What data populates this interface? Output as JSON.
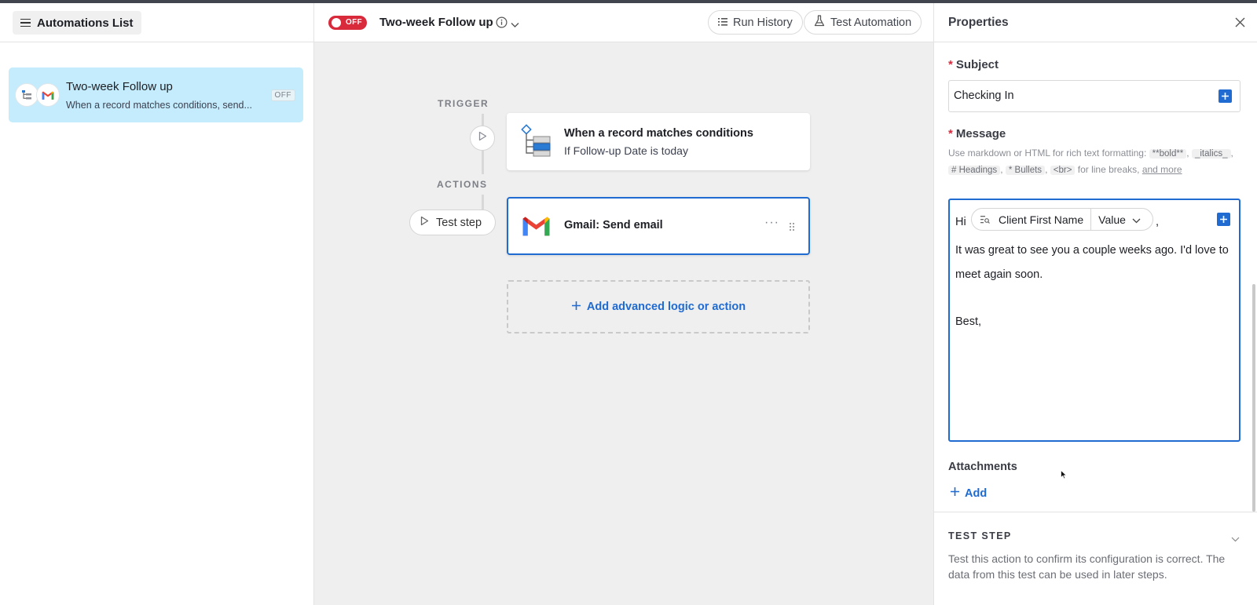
{
  "left": {
    "list_button_label": "Automations List",
    "item": {
      "title": "Two-week Follow up",
      "subtitle": "When a record matches conditions, send...",
      "status": "OFF"
    }
  },
  "header": {
    "toggle_label": "OFF",
    "automation_name": "Two-week Follow up",
    "run_history_label": "Run History",
    "test_automation_label": "Test Automation"
  },
  "canvas": {
    "trigger_label": "TRIGGER",
    "actions_label": "ACTIONS",
    "trigger_card": {
      "title": "When a record matches conditions",
      "subtitle": "If Follow-up Date is today"
    },
    "test_step_label": "Test step",
    "action_card": {
      "title": "Gmail: Send email",
      "more": "···"
    },
    "add_label": "Add advanced logic or action"
  },
  "properties": {
    "title": "Properties",
    "subject_label": "Subject",
    "subject_value": "Checking In",
    "message_label": "Message",
    "help": {
      "prefix": "Use markdown or HTML for rich text formatting:",
      "bold": "**bold**",
      "italics": "_italics_",
      "headings": "# Headings",
      "bullets": "* Bullets",
      "br": "<br>",
      "suffix": "for line breaks,",
      "link": "and more",
      "sep": ","
    },
    "message": {
      "greeting": "Hi",
      "token_field": "Client First Name",
      "token_mode": "Value",
      "comma": ",",
      "body": "It was great to see you a couple weeks ago. I'd love to meet again soon.",
      "signoff": "Best,"
    },
    "attachments_label": "Attachments",
    "attachments_add": "Add",
    "test_step_title": "TEST STEP",
    "test_step_desc": "Test this action to confirm its configuration is correct. The data from this test can be used in later steps."
  },
  "colors": {
    "accent": "#1f6bd1",
    "toggle_off": "#d92a3c",
    "selected_item": "#c4ecfc",
    "canvas_bg": "#efefef"
  }
}
